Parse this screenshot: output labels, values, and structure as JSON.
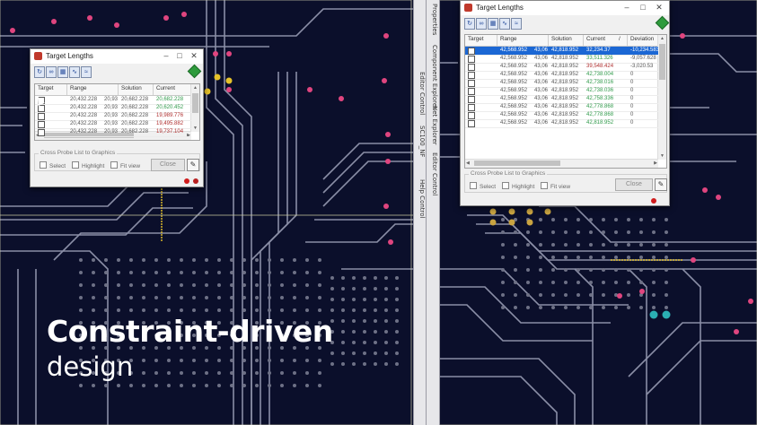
{
  "colors": {
    "board": "#0b0f2b",
    "trace": "#8a8ea6",
    "pad_pink": "#e0457f",
    "pad_yellow": "#e6c22a",
    "pad_teal": "#2bb0b4",
    "selected_row": "#1b67d4",
    "value_green": "#2f9a4a",
    "value_red": "#b03030"
  },
  "side_tabs": [
    {
      "text": "Properties"
    },
    {
      "text": "Component Explorer"
    },
    {
      "text": "Net Explorer"
    },
    {
      "text": "Editor Control"
    }
  ],
  "left_tabs": [
    {
      "text": "Help Control"
    },
    {
      "text": "SC100_NF"
    },
    {
      "text": "Editor Control"
    }
  ],
  "dialog_left": {
    "title": "Target Lengths",
    "toolbar_icons": [
      "refresh-icon",
      "link-icon",
      "table-icon",
      "tune-icon",
      "pattern-icon"
    ],
    "columns": [
      "Target",
      "Range",
      "Solution",
      "Current"
    ],
    "rows": [
      {
        "range": "20,432.228",
        "range2": "20,93",
        "solution": "20,682.228",
        "current": "20,682.228",
        "cur_color": "green"
      },
      {
        "range": "20,432.228",
        "range2": "20,93",
        "solution": "20,682.228",
        "current": "20,620.452",
        "cur_color": "green"
      },
      {
        "range": "20,432.228",
        "range2": "20,93",
        "solution": "20,682.228",
        "current": "19,989.776",
        "cur_color": "red"
      },
      {
        "range": "20,432.228",
        "range2": "20,93",
        "solution": "20,682.228",
        "current": "19,495.882",
        "cur_color": "red"
      },
      {
        "range": "20,432.228",
        "range2": "20,93",
        "solution": "20,682.228",
        "current": "19,737.104",
        "cur_color": "red"
      }
    ],
    "group_label": "Cross Probe List to Graphics",
    "options": [
      "Select",
      "Highlight",
      "Fit view"
    ],
    "close_label": "Close"
  },
  "dialog_right": {
    "title": "Target Lengths",
    "toolbar_icons": [
      "refresh-icon",
      "link-icon",
      "table-icon",
      "tune-icon",
      "pattern-icon"
    ],
    "columns": [
      "Target",
      "Range",
      "Solution",
      "Current",
      "/",
      "Deviation"
    ],
    "rows": [
      {
        "range": "42,568.952",
        "range2": "43,06",
        "solution": "42,818.952",
        "current": "32,234.37",
        "deviation": "-10,234.583",
        "cur_color": "sel"
      },
      {
        "range": "42,568.952",
        "range2": "43,06",
        "solution": "42,818.952",
        "current": "33,511.326",
        "deviation": "-9,057.628",
        "cur_color": "green"
      },
      {
        "range": "42,568.952",
        "range2": "43,06",
        "solution": "42,818.952",
        "current": "39,548.424",
        "deviation": "-3,020.53",
        "cur_color": "red"
      },
      {
        "range": "42,568.952",
        "range2": "43,06",
        "solution": "42,818.952",
        "current": "42,738.004",
        "deviation": "0",
        "cur_color": "green"
      },
      {
        "range": "42,568.952",
        "range2": "43,06",
        "solution": "42,818.952",
        "current": "42,738.016",
        "deviation": "0",
        "cur_color": "green"
      },
      {
        "range": "42,568.952",
        "range2": "43,06",
        "solution": "42,818.952",
        "current": "42,738.036",
        "deviation": "0",
        "cur_color": "green"
      },
      {
        "range": "42,568.952",
        "range2": "43,06",
        "solution": "42,818.952",
        "current": "42,758.336",
        "deviation": "0",
        "cur_color": "green"
      },
      {
        "range": "42,568.952",
        "range2": "43,06",
        "solution": "42,818.952",
        "current": "42,778.868",
        "deviation": "0",
        "cur_color": "green"
      },
      {
        "range": "42,568.952",
        "range2": "43,06",
        "solution": "42,818.952",
        "current": "42,778.868",
        "deviation": "0",
        "cur_color": "green"
      },
      {
        "range": "42,568.952",
        "range2": "43,06",
        "solution": "42,818.952",
        "current": "42,818.952",
        "deviation": "0",
        "cur_color": "green"
      }
    ],
    "group_label": "Cross Probe List to Graphics",
    "options": [
      "Select",
      "Highlight",
      "Fit view"
    ],
    "close_label": "Close"
  },
  "caption": {
    "line1": "Constraint-driven",
    "line2": "design"
  }
}
